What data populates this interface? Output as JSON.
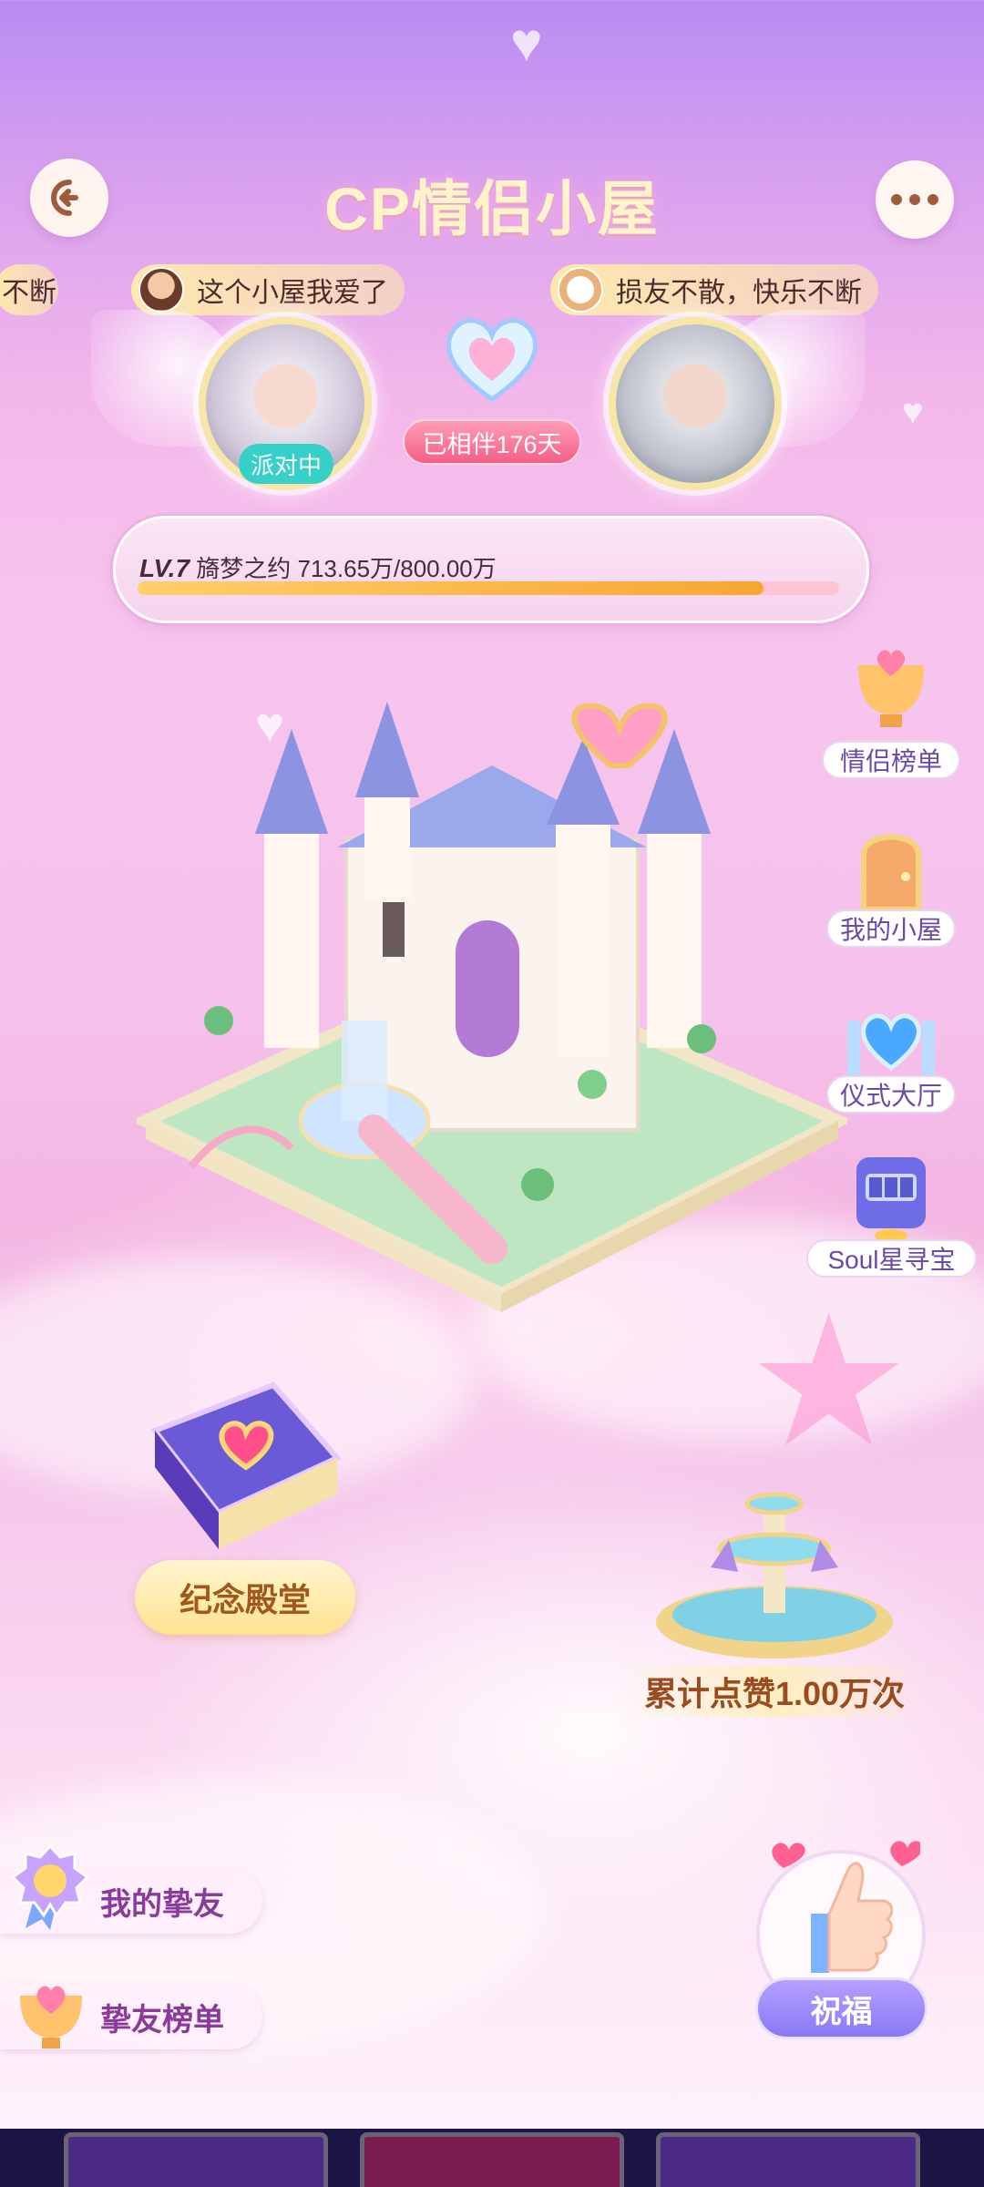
{
  "header": {
    "title": "CP情侣小屋",
    "back_icon": "back-arrow-icon",
    "more_icon": "more-dots-icon"
  },
  "danmaku": [
    {
      "text": "不断"
    },
    {
      "text": "这个小屋我爱了"
    },
    {
      "text": "损友不散，快乐不断"
    }
  ],
  "couple": {
    "status": "派对中",
    "days": "已相伴176天"
  },
  "level": {
    "lv": "LV.7",
    "name": "旖梦之约",
    "progress_text": "713.65万/800.00万",
    "progress": 0.892
  },
  "side_menu": [
    {
      "label": "情侣榜单",
      "icon": "trophy-heart-icon"
    },
    {
      "label": "我的小屋",
      "icon": "door-icon"
    },
    {
      "label": "仪式大厅",
      "icon": "crystal-heart-icon"
    },
    {
      "label": "Soul星寻宝",
      "icon": "slot-machine-icon"
    }
  ],
  "memorial": {
    "label": "纪念殿堂"
  },
  "likes": {
    "label": "累计点赞1.00万次"
  },
  "friends": {
    "my_friends": "我的挚友",
    "friends_rank": "挚友榜单"
  },
  "bless": {
    "label": "祝福"
  },
  "colors": {
    "accent": "#8b78f4",
    "gold": "#ffe28f",
    "status": "#35d0c8",
    "pink": "#f55f88"
  }
}
